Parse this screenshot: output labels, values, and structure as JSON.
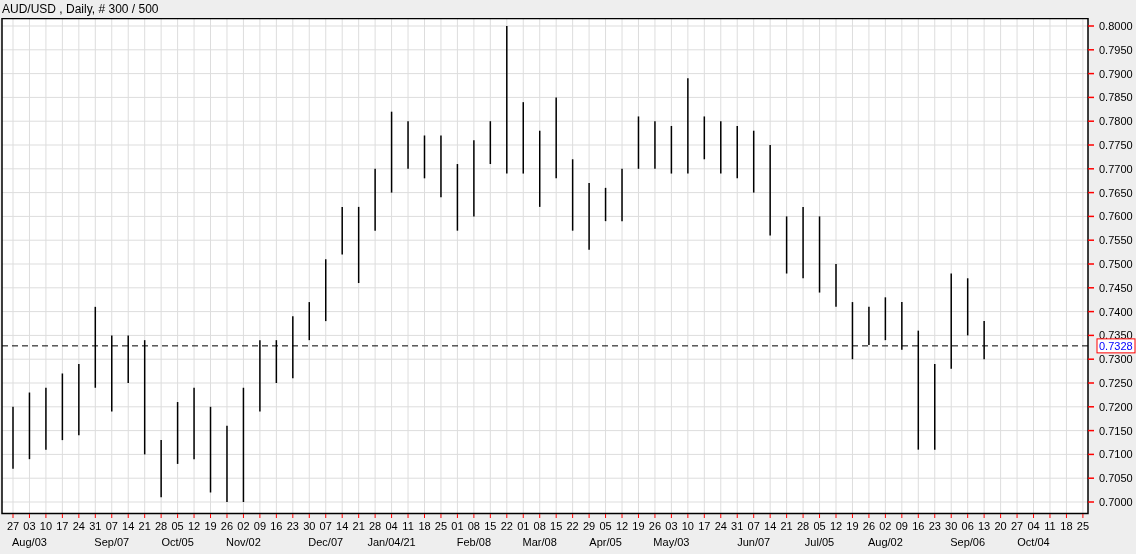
{
  "title": "AUD/USD , Daily, # 300 / 500",
  "price_axis": [
    "0.8000",
    "0.7950",
    "0.7900",
    "0.7850",
    "0.7800",
    "0.7750",
    "0.7700",
    "0.7650",
    "0.7600",
    "0.7550",
    "0.7500",
    "0.7450",
    "0.7400",
    "0.7350",
    "0.7300",
    "0.7250",
    "0.7200",
    "0.7150",
    "0.7100",
    "0.7050",
    "0.7000"
  ],
  "current_price": "0.7328",
  "date_axis": [
    {
      "day": "27"
    },
    {
      "day": "03",
      "month": "Aug/03"
    },
    {
      "day": "10"
    },
    {
      "day": "17"
    },
    {
      "day": "24"
    },
    {
      "day": "31"
    },
    {
      "day": "07",
      "month": "Sep/07"
    },
    {
      "day": "14"
    },
    {
      "day": "21"
    },
    {
      "day": "28"
    },
    {
      "day": "05",
      "month": "Oct/05"
    },
    {
      "day": "12"
    },
    {
      "day": "19"
    },
    {
      "day": "26"
    },
    {
      "day": "02",
      "month": "Nov/02"
    },
    {
      "day": "09"
    },
    {
      "day": "16"
    },
    {
      "day": "23"
    },
    {
      "day": "30"
    },
    {
      "day": "07",
      "month": "Dec/07"
    },
    {
      "day": "14"
    },
    {
      "day": "21"
    },
    {
      "day": "28"
    },
    {
      "day": "04",
      "month": "Jan/04/21"
    },
    {
      "day": "11"
    },
    {
      "day": "18"
    },
    {
      "day": "25"
    },
    {
      "day": "01"
    },
    {
      "day": "08",
      "month": "Feb/08"
    },
    {
      "day": "15"
    },
    {
      "day": "22"
    },
    {
      "day": "01"
    },
    {
      "day": "08",
      "month": "Mar/08"
    },
    {
      "day": "15"
    },
    {
      "day": "22"
    },
    {
      "day": "29"
    },
    {
      "day": "05",
      "month": "Apr/05"
    },
    {
      "day": "12"
    },
    {
      "day": "19"
    },
    {
      "day": "26"
    },
    {
      "day": "03",
      "month": "May/03"
    },
    {
      "day": "10"
    },
    {
      "day": "17"
    },
    {
      "day": "24"
    },
    {
      "day": "31"
    },
    {
      "day": "07",
      "month": "Jun/07"
    },
    {
      "day": "14"
    },
    {
      "day": "21"
    },
    {
      "day": "28"
    },
    {
      "day": "05",
      "month": "Jul/05"
    },
    {
      "day": "12"
    },
    {
      "day": "19"
    },
    {
      "day": "26"
    },
    {
      "day": "02",
      "month": "Aug/02"
    },
    {
      "day": "09"
    },
    {
      "day": "16"
    },
    {
      "day": "23"
    },
    {
      "day": "30"
    },
    {
      "day": "06",
      "month": "Sep/06"
    },
    {
      "day": "13"
    },
    {
      "day": "20"
    },
    {
      "day": "27"
    },
    {
      "day": "04",
      "month": "Oct/04"
    },
    {
      "day": "11"
    },
    {
      "day": "18"
    },
    {
      "day": "25"
    }
  ]
}
